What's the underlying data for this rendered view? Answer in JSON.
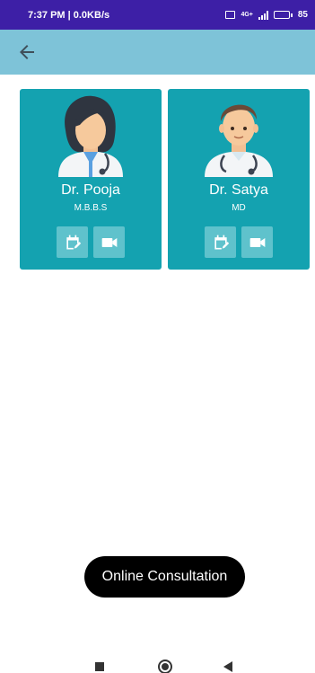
{
  "status_bar": {
    "time_speed": "7:37 PM | 0.0KB/s",
    "network": "4G+",
    "battery": "85"
  },
  "app_bar": {
    "back_icon": "arrow-left-icon"
  },
  "doctors": [
    {
      "name": "Dr. Pooja",
      "degree": "M.B.B.S",
      "avatar": "female-doctor-avatar"
    },
    {
      "name": "Dr. Satya",
      "degree": "MD",
      "avatar": "male-doctor-avatar"
    }
  ],
  "card_actions": [
    "calendar-edit-icon",
    "video-camera-icon"
  ],
  "toast": {
    "text": "Online Consultation"
  },
  "colors": {
    "status_bar": "#3d1fa6",
    "app_bar": "#7ec3d8",
    "card": "#14a2b0",
    "action_button": "#5fc2cc"
  }
}
